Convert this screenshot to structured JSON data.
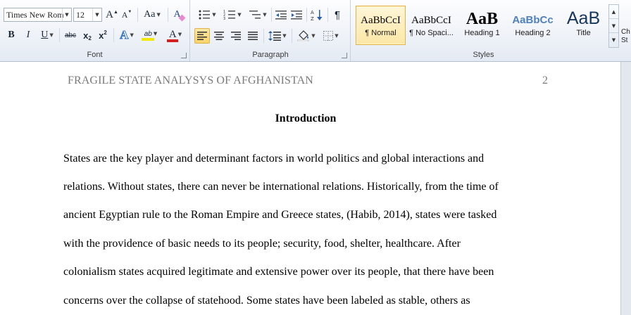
{
  "ribbon": {
    "font": {
      "label": "Font",
      "font_name": "Times New Rom",
      "font_size": "12",
      "grow_font": "A",
      "shrink_font": "A",
      "change_case": "Aa",
      "clear_format": "A",
      "bold": "B",
      "italic": "I",
      "underline": "U",
      "strikethrough": "abc",
      "subscript": "x",
      "superscript": "x",
      "text_effects": "A",
      "highlight": "ab",
      "font_color": "A",
      "highlight_color": "#f5e800",
      "font_color_value": "#d62020"
    },
    "paragraph": {
      "label": "Paragraph",
      "pilcrow": "¶"
    },
    "styles": {
      "label": "Styles",
      "items": [
        {
          "sample": "AaBbCcI",
          "name": "¶ Normal"
        },
        {
          "sample": "AaBbCcI",
          "name": "¶ No Spaci..."
        },
        {
          "sample": "AaB",
          "name": "Heading 1"
        },
        {
          "sample": "AaBbCc",
          "name": "Heading 2"
        },
        {
          "sample": "AaB",
          "name": "Title"
        }
      ],
      "change_styles": "Ch\nSt"
    }
  },
  "document": {
    "running_head": "FRAGILE STATE ANALYSYS OF AFGHANISTAN",
    "page_number": "2",
    "heading": "Introduction",
    "lines": [
      "States are the key player and determinant factors in world politics and global interactions and",
      "relations. Without states, there can never be international relations. Historically, from the time of",
      "ancient Egyptian rule to the Roman Empire and Greece states, (Habib, 2014), states were tasked",
      "with the providence of basic needs to its people; security, food, shelter, healthcare. After",
      "colonialism states acquired legitimate and extensive power over its people, that there have been",
      "concerns over the collapse of statehood. Some states have been labeled as stable, others as"
    ]
  }
}
